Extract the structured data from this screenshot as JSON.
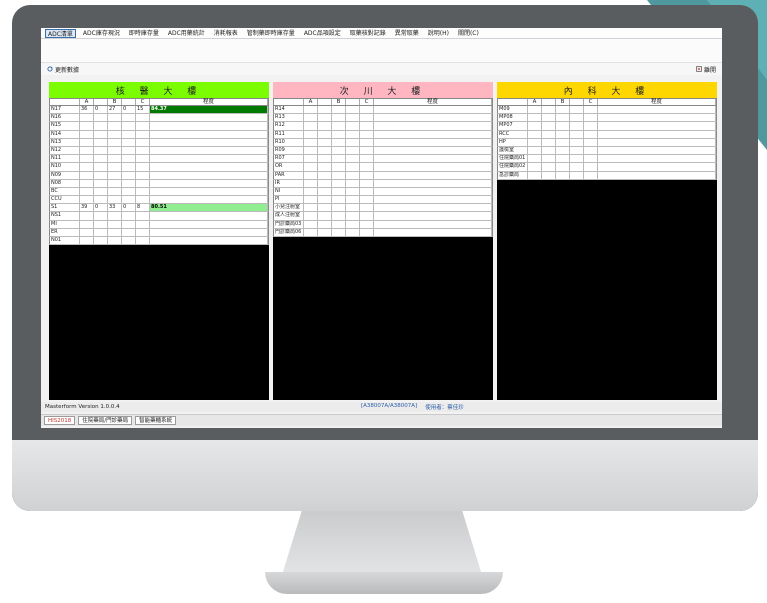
{
  "menu": [
    "ADC清單",
    "ADC庫存現況",
    "即時庫存量",
    "ADC用藥統計",
    "消耗報表",
    "管制藥即時庫存量",
    "ADC品項設定",
    "取藥核對記錄",
    "異常取藥",
    "說明(H)",
    "關閉(C)"
  ],
  "toolbar": {
    "refresh_label": "更新數據",
    "close_label": "離開"
  },
  "colors": {
    "panel1": "#7cfc00",
    "panel2": "#ffb6c1",
    "panel3": "#ffd700",
    "fill_dark": "#007a00",
    "fill_light": "#90ee90"
  },
  "panels": [
    {
      "title": "核 醫 大 樓",
      "header": [
        "",
        "A",
        "",
        "B",
        "",
        "C",
        "程度"
      ],
      "rows": [
        [
          "N17",
          "1",
          "36",
          "0",
          "27",
          "0",
          "15",
          "84.37"
        ],
        [
          "N16",
          "",
          "",
          "",
          "",
          "",
          "",
          ""
        ],
        [
          "N15",
          "",
          "",
          "",
          "",
          "",
          "",
          ""
        ],
        [
          "N14",
          "",
          "",
          "",
          "",
          "",
          "",
          ""
        ],
        [
          "N13",
          "",
          "",
          "",
          "",
          "",
          "",
          ""
        ],
        [
          "N12",
          "",
          "",
          "",
          "",
          "",
          "",
          ""
        ],
        [
          "N11",
          "",
          "",
          "",
          "",
          "",
          "",
          ""
        ],
        [
          "N10",
          "",
          "",
          "",
          "",
          "",
          "",
          ""
        ],
        [
          "N09",
          "",
          "",
          "",
          "",
          "",
          "",
          ""
        ],
        [
          "N08",
          "",
          "",
          "",
          "",
          "",
          "",
          ""
        ],
        [
          "BC",
          "",
          "",
          "",
          "",
          "",
          "",
          ""
        ],
        [
          "CCU",
          "",
          "",
          "",
          "",
          "",
          "",
          ""
        ],
        [
          "S1",
          "1",
          "39",
          "0",
          "33",
          "0",
          "8",
          "80.51"
        ],
        [
          "NS1",
          "",
          "",
          "",
          "",
          "",
          "",
          ""
        ],
        [
          "MI",
          "",
          "",
          "",
          "",
          "",
          "",
          ""
        ],
        [
          "ER",
          "",
          "",
          "",
          "",
          "",
          "",
          ""
        ],
        [
          "N01",
          "",
          "",
          "",
          "",
          "",
          "",
          ""
        ]
      ]
    },
    {
      "title": "次 川 大 樓",
      "header": [
        "",
        "A",
        "",
        "B",
        "",
        "C",
        "程度"
      ],
      "rows": [
        [
          "R14"
        ],
        [
          "R13"
        ],
        [
          "R12"
        ],
        [
          "R11"
        ],
        [
          "R10"
        ],
        [
          "R09"
        ],
        [
          "R07"
        ],
        [
          "OR"
        ],
        [
          "PAR"
        ],
        [
          "IR"
        ],
        [
          "NI"
        ],
        [
          "PI"
        ],
        [
          "小兒注射室"
        ],
        [
          "成人注射室"
        ],
        [
          "門診藥局03"
        ],
        [
          "門診藥局06"
        ]
      ]
    },
    {
      "title": "內 科 大 樓",
      "header": [
        "",
        "A",
        "",
        "B",
        "",
        "C",
        "程度"
      ],
      "rows": [
        [
          "M09"
        ],
        [
          "MP08"
        ],
        [
          "MP07"
        ],
        [
          "RCC"
        ],
        [
          "HP"
        ],
        [
          "護檢室"
        ],
        [
          "住院藥局01"
        ],
        [
          "住院藥局02"
        ],
        [
          "急診藥局"
        ]
      ]
    }
  ],
  "status": {
    "version": "Masterform Version 1.0.0.4",
    "station": "[A38007A/A38007A]",
    "user": "使用者：蔡佳珍"
  },
  "taskbar": [
    "HIS2018",
    "住院藥局/門診藥局",
    "智能藥櫃系統"
  ]
}
